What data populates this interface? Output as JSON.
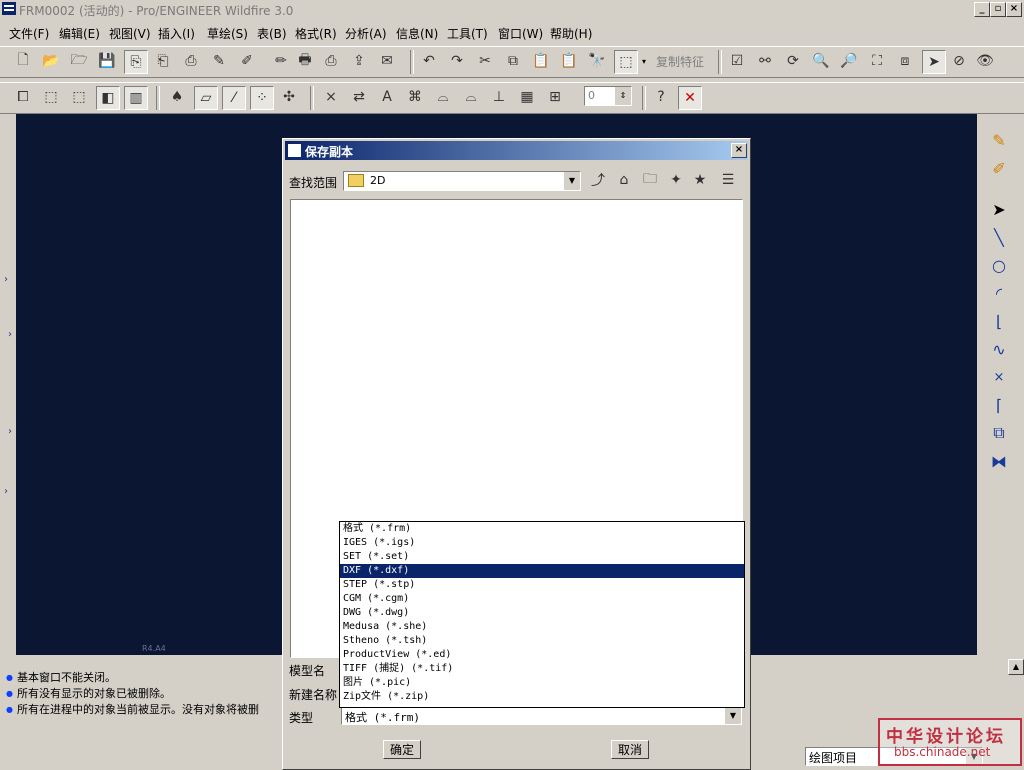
{
  "window": {
    "title": "FRM0002 (活动的) - Pro/ENGINEER Wildfire 3.0",
    "minimize": "_",
    "restore": "▫",
    "close": "×"
  },
  "menubar": [
    "文件(F)",
    "编辑(E)",
    "视图(V)",
    "插入(I)",
    "草绘(S)",
    "表(B)",
    "格式(R)",
    "分析(A)",
    "信息(N)",
    "工具(T)",
    "窗口(W)",
    "帮助(H)"
  ],
  "toolbar": {
    "copy_feature": "复制特征",
    "spin_value": "0"
  },
  "canvas": {
    "corner_label": "R4.A4"
  },
  "messages": [
    "基本窗口不能关闭。",
    "所有没有显示的对象已被删除。",
    "所有在进程中的对象当前被显示。没有对象将被删"
  ],
  "status": {
    "selector_value": "绘图项目"
  },
  "dialog": {
    "title": "保存副本",
    "close": "×",
    "look_in_label": "查找范围",
    "look_in_value": "2D",
    "model_name_label": "模型名",
    "new_name_label": "新建名称",
    "type_label": "类型",
    "type_value": "格式 (*.frm)",
    "ok_label": "确定",
    "cancel_label": "取消",
    "type_options": [
      "格式 (*.frm)",
      "IGES (*.igs)",
      "SET (*.set)",
      "DXF (*.dxf)",
      "STEP (*.stp)",
      "CGM (*.cgm)",
      "DWG (*.dwg)",
      "Medusa (*.she)",
      "Stheno (*.tsh)",
      "ProductView (*.ed)",
      "TIFF (捕捉) (*.tif)",
      "图片 (*.pic)",
      "Zip文件 (*.zip)"
    ],
    "selected_index": 3
  },
  "watermark": {
    "line1": "中华设计论坛",
    "line2": "bbs.chinade.net"
  },
  "colors": {
    "canvas": "#0b1633",
    "selection": "#0a246a",
    "message_bullet": "#1040ff",
    "watermark": "#c03040"
  }
}
